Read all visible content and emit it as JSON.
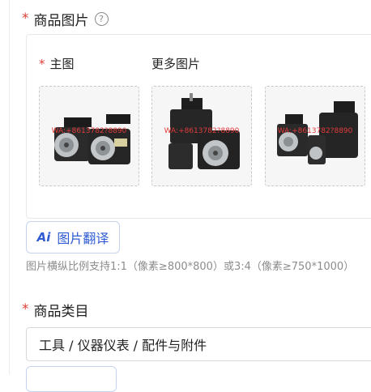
{
  "product_images": {
    "required_mark": "*",
    "title": "商品图片",
    "help_icon": "question-circle-icon",
    "main_image": {
      "required_mark": "*",
      "label": "主图"
    },
    "more_images": {
      "label": "更多图片"
    },
    "watermark": "WA:+8613782?8890",
    "translate_button": {
      "icon": "ai-icon",
      "icon_text": "Ai",
      "label": "图片翻译"
    },
    "hint": "图片横纵比例支持1:1（像素≥800*800）或3:4（像素≥750*1000）"
  },
  "product_category": {
    "required_mark": "*",
    "title": "商品类目",
    "value": "工具 / 仪器仪表 / 配件与附件"
  },
  "colors": {
    "required": "#e0403a",
    "accent": "#2f5bd3",
    "hint": "#8c8c8c"
  }
}
